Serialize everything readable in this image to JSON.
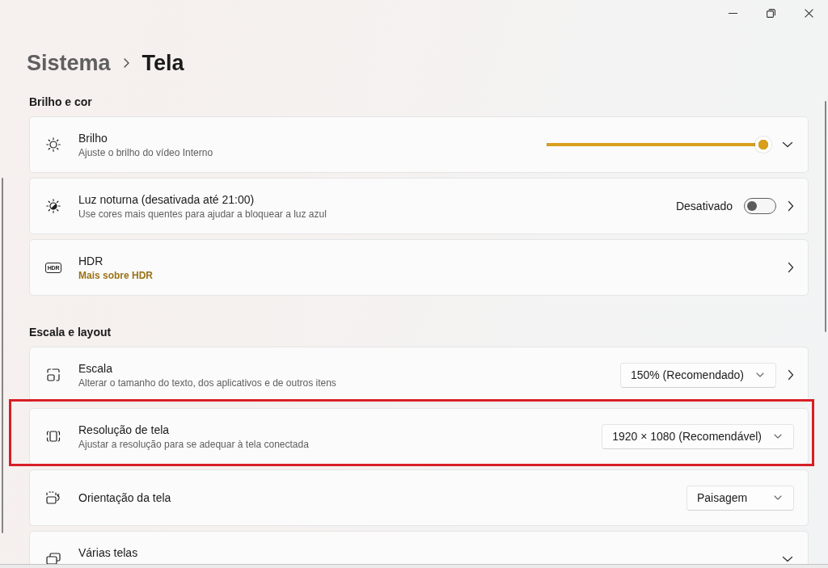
{
  "breadcrumb": [
    {
      "label": "Sistema",
      "current": false
    },
    {
      "label": "Tela",
      "current": true
    }
  ],
  "sections": [
    {
      "title": "Brilho e cor",
      "items": [
        {
          "kind": "slider",
          "title": "Brilho",
          "subtitle": "Ajuste o brilho do vídeo Interno",
          "level": 1,
          "expanded": false,
          "opens_page": false,
          "highlighted": false
        },
        {
          "kind": "toggle",
          "title": "Luz noturna (desativada até 21:00)",
          "subtitle": "Use cores mais quentes para ajudar a bloquear a luz azul",
          "state_label": "Desativado",
          "on": false,
          "opens_page": true,
          "highlighted": false
        },
        {
          "kind": "link",
          "icon_text": "HDR",
          "title": "HDR",
          "link": "Mais sobre HDR",
          "opens_page": true,
          "highlighted": false
        }
      ]
    },
    {
      "title": "Escala e layout",
      "items": [
        {
          "kind": "dropdown",
          "title": "Escala",
          "subtitle": "Alterar o tamanho do texto, dos aplicativos e de outros itens",
          "value": "150% (Recomendado)",
          "opens_page": true,
          "highlighted": false
        },
        {
          "kind": "dropdown",
          "title": "Resolução de tela",
          "subtitle": "Ajustar a resolução para se adequar à tela conectada",
          "value": "1920 × 1080 (Recomendável)",
          "opens_page": false,
          "highlighted": true
        },
        {
          "kind": "dropdown",
          "title": "Orientação da tela",
          "value": "Paisagem",
          "opens_page": false,
          "highlighted": false
        },
        {
          "kind": "expander",
          "title": "Várias telas",
          "expanded": false,
          "opens_page": false,
          "highlighted": false
        }
      ]
    }
  ]
}
